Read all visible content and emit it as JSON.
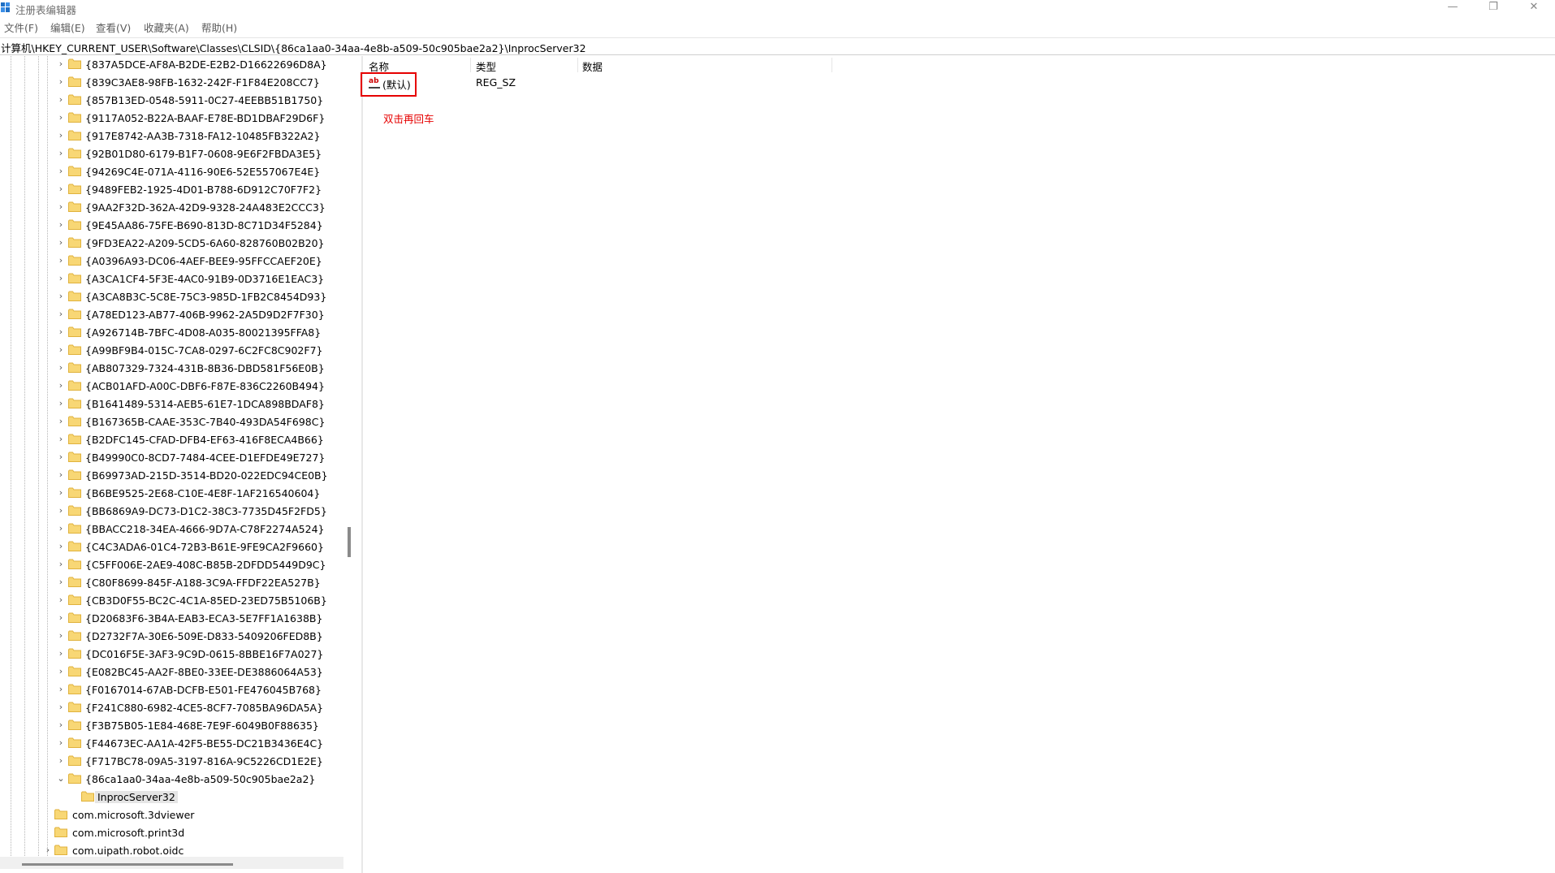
{
  "window": {
    "title": "注册表编辑器",
    "controls": {
      "minimize": "—",
      "maximize": "❐",
      "close": "✕"
    }
  },
  "menu": [
    "文件(F)",
    "编辑(E)",
    "查看(V)",
    "收藏夹(A)",
    "帮助(H)"
  ],
  "address": "计算机\\HKEY_CURRENT_USER\\Software\\Classes\\CLSID\\{86ca1aa0-34aa-4e8b-a509-50c905bae2a2}\\InprocServer32",
  "tree": {
    "keys": [
      "{837A5DCE-AF8A-B2DE-E2B2-D16622696D8A}",
      "{839C3AE8-98FB-1632-242F-F1F84E208CC7}",
      "{857B13ED-0548-5911-0C27-4EEBB51B1750}",
      "{9117A052-B22A-BAAF-E78E-BD1DBAF29D6F}",
      "{917E8742-AA3B-7318-FA12-10485FB322A2}",
      "{92B01D80-6179-B1F7-0608-9E6F2FBDA3E5}",
      "{94269C4E-071A-4116-90E6-52E557067E4E}",
      "{9489FEB2-1925-4D01-B788-6D912C70F7F2}",
      "{9AA2F32D-362A-42D9-9328-24A483E2CCC3}",
      "{9E45AA86-75FE-B690-813D-8C71D34F5284}",
      "{9FD3EA22-A209-5CD5-6A60-828760B02B20}",
      "{A0396A93-DC06-4AEF-BEE9-95FFCCAEF20E}",
      "{A3CA1CF4-5F3E-4AC0-91B9-0D3716E1EAC3}",
      "{A3CA8B3C-5C8E-75C3-985D-1FB2C8454D93}",
      "{A78ED123-AB77-406B-9962-2A5D9D2F7F30}",
      "{A926714B-7BFC-4D08-A035-80021395FFA8}",
      "{A99BF9B4-015C-7CA8-0297-6C2FC8C902F7}",
      "{AB807329-7324-431B-8B36-DBD581F56E0B}",
      "{ACB01AFD-A00C-DBF6-F87E-836C2260B494}",
      "{B1641489-5314-AEB5-61E7-1DCA898BDAF8}",
      "{B167365B-CAAE-353C-7B40-493DA54F698C}",
      "{B2DFC145-CFAD-DFB4-EF63-416F8ECA4B66}",
      "{B49990C0-8CD7-7484-4CEE-D1EFDE49E727}",
      "{B69973AD-215D-3514-BD20-022EDC94CE0B}",
      "{B6BE9525-2E68-C10E-4E8F-1AF216540604}",
      "{BB6869A9-DC73-D1C2-38C3-7735D45F2FD5}",
      "{BBACC218-34EA-4666-9D7A-C78F2274A524}",
      "{C4C3ADA6-01C4-72B3-B61E-9FE9CA2F9660}",
      "{C5FF006E-2AE9-408C-B85B-2DFDD5449D9C}",
      "{C80F8699-845F-A188-3C9A-FFDF22EA527B}",
      "{CB3D0F55-BC2C-4C1A-85ED-23ED75B5106B}",
      "{D20683F6-3B4A-EAB3-ECA3-5E7FF1A1638B}",
      "{D2732F7A-30E6-509E-D833-5409206FED8B}",
      "{DC016F5E-3AF3-9C9D-0615-8BBE16F7A027}",
      "{E082BC45-AA2F-8BE0-33EE-DE3886064A53}",
      "{F0167014-67AB-DCFB-E501-FE476045B768}",
      "{F241C880-6982-4CE5-8CF7-7085BA96DA5A}",
      "{F3B75B05-1E84-468E-7E9F-6049B0F88635}",
      "{F44673EC-AA1A-42F5-BE55-DC21B3436E4C}",
      "{F717BC78-09A5-3197-816A-9C5226CD1E2E}"
    ],
    "expanded_key": "{86ca1aa0-34aa-4e8b-a509-50c905bae2a2}",
    "selected_subkey": "InprocServer32",
    "siblings": [
      "com.microsoft.3dviewer",
      "com.microsoft.print3d",
      "com.uipath.robot.oidc"
    ]
  },
  "values_pane": {
    "columns": [
      "名称",
      "类型",
      "数据"
    ],
    "rows": [
      {
        "name": "(默认)",
        "type": "REG_SZ",
        "data": "",
        "icon": "string-value-icon"
      }
    ],
    "annotation": "双击再回车",
    "annotation_color": "#e60000"
  },
  "colors": {
    "folder": "#f8d775",
    "folder_dark": "#e0b23c",
    "accent_red": "#e60000"
  }
}
